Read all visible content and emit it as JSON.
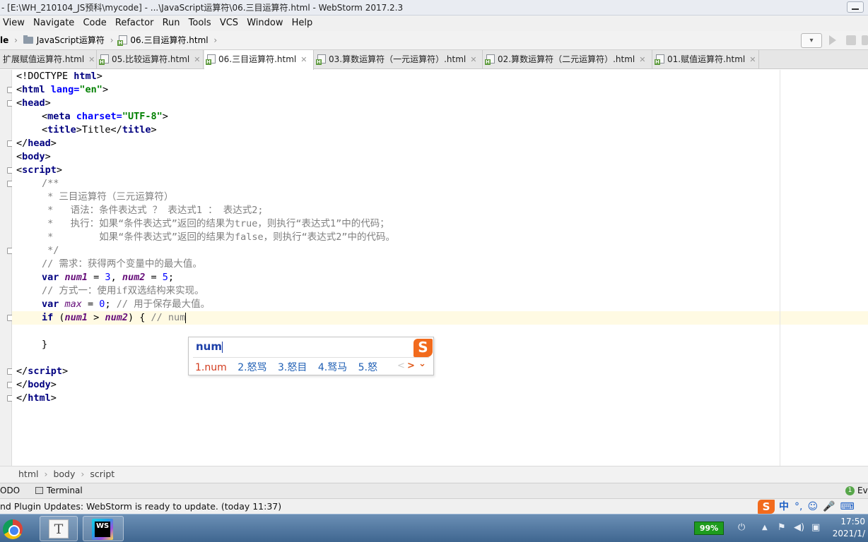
{
  "window": {
    "title": "- [E:\\WH_210104_JS预科\\mycode] - ...\\JavaScript运算符\\06.三目运算符.html - WebStorm 2017.2.3"
  },
  "menu": [
    "View",
    "Navigate",
    "Code",
    "Refactor",
    "Run",
    "Tools",
    "VCS",
    "Window",
    "Help"
  ],
  "nav": {
    "project_label": "le",
    "folder": "JavaScript运算符",
    "file": "06.三目运算符.html"
  },
  "tabs": [
    {
      "label": "扩展赋值运算符.html",
      "active": false,
      "icon": "none"
    },
    {
      "label": "05.比较运算符.html",
      "active": false,
      "icon": "html-file-icon"
    },
    {
      "label": "06.三目运算符.html",
      "active": true,
      "icon": "html-file-icon"
    },
    {
      "label": "03.算数运算符（一元运算符）.html",
      "active": false,
      "icon": "html-file-icon"
    },
    {
      "label": "02.算数运算符（二元运算符）.html",
      "active": false,
      "icon": "html-file-icon"
    },
    {
      "label": "01.赋值运算符.html",
      "active": false,
      "icon": "html-file-icon"
    }
  ],
  "tab_close": "✕",
  "code": {
    "l1": {
      "a": "<!DOCTYPE ",
      "b": "html",
      "c": ">"
    },
    "l2": {
      "a": "<",
      "tag": "html ",
      "attr": "lang=",
      "val": "\"en\"",
      "z": ">"
    },
    "l3": {
      "a": "<",
      "tag": "head",
      "z": ">"
    },
    "l4": {
      "a": "<",
      "tag": "meta ",
      "attr": "charset=",
      "val": "\"UTF-8\"",
      "z": ">"
    },
    "l5": {
      "a": "<",
      "tag": "title",
      "m": ">Title</",
      "tag2": "title",
      "z": ">"
    },
    "l6": {
      "a": "</",
      "tag": "head",
      "z": ">"
    },
    "l7": {
      "a": "<",
      "tag": "body",
      "z": ">"
    },
    "l8": {
      "a": "<",
      "tag": "script",
      "z": ">"
    },
    "l9": "/**",
    "l10": " * 三目运算符（三元运算符）",
    "l11": " *   语法：条件表达式 ？ 表达式1 ： 表达式2;",
    "l12": " *   执行：如果“条件表达式”返回的结果为true，则执行“表达式1”中的代码；",
    "l13": " *        如果“条件表达式”返回的结果为false，则执行“表达式2”中的代码。",
    "l14": " */",
    "l15": "// 需求：获得两个变量中的最大值。",
    "l16": {
      "kw": "var ",
      "v1": "num1",
      "p1": " = ",
      "n1": "3",
      "p2": ", ",
      "v2": "num2",
      "p3": " = ",
      "n2": "5",
      "p4": ";"
    },
    "l17": "// 方式一：使用if双选结构来实现。",
    "l18": {
      "kw": "var ",
      "v1": "max",
      "p1": " = ",
      "n1": "0",
      "p2": "; ",
      "c": "// 用于保存最大值。"
    },
    "l19": {
      "kw": "if ",
      "p1": "(",
      "v1": "num1",
      "p2": " > ",
      "v2": "num2",
      "p3": ") { ",
      "c": "// num"
    },
    "l21": "}",
    "l23": {
      "a": "</",
      "tag": "script",
      "z": ">"
    },
    "l24": {
      "a": "</",
      "tag": "body",
      "z": ">"
    },
    "l25": {
      "a": "</",
      "tag": "html",
      "z": ">"
    }
  },
  "ime": {
    "composition": "num",
    "candidates": [
      "1.num",
      "2.怒骂",
      "3.怒目",
      "4.驽马",
      "5.怒"
    ],
    "prev": "<",
    "next": ">",
    "expand": "⌄",
    "logo": "S"
  },
  "breadcrumb": [
    "html",
    "body",
    "script"
  ],
  "toolwindows": {
    "todo": "ODO",
    "terminal": "Terminal",
    "event_count": "1",
    "event_label": "Ev"
  },
  "status": {
    "message": "nd Plugin Updates: WebStorm is ready to update. (today 11:37)"
  },
  "imebar": {
    "logo": "S",
    "lang": "中",
    "punct": "°,",
    "emoji": "☺",
    "mic": "🎤",
    "kbd": "⌨"
  },
  "taskbar": {
    "doc_letter": "T",
    "ws_text": "WS",
    "battery": "99%",
    "time": "17:50",
    "date": "2021/1/"
  }
}
